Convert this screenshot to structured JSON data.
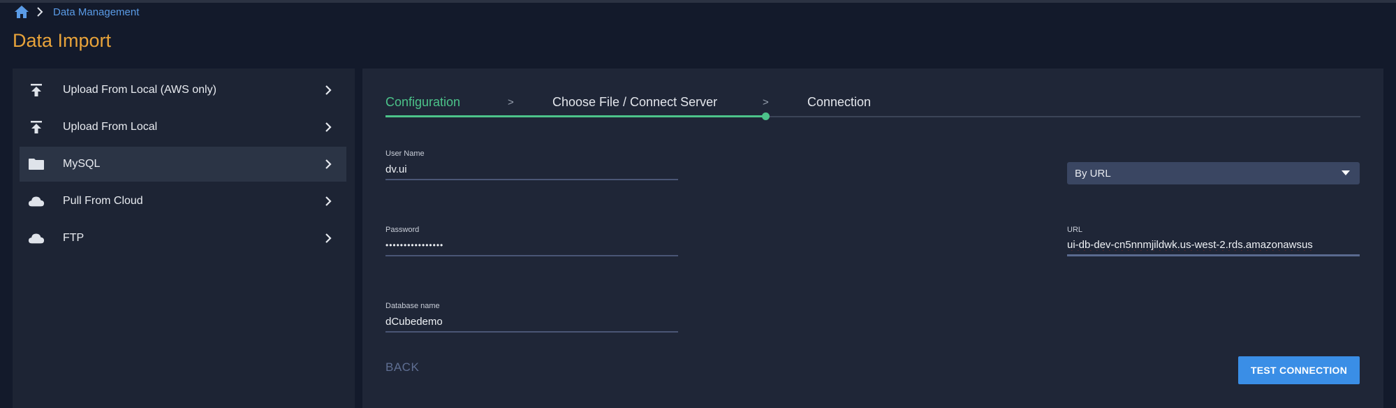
{
  "breadcrumb": {
    "items": [
      "Data Management"
    ]
  },
  "page": {
    "title": "Data Import"
  },
  "sidebar": {
    "items": [
      {
        "label": "Upload From Local (AWS only)",
        "icon": "upload-icon"
      },
      {
        "label": "Upload From Local",
        "icon": "upload-icon"
      },
      {
        "label": "MySQL",
        "icon": "folder-icon",
        "active": true
      },
      {
        "label": "Pull From Cloud",
        "icon": "cloud-icon"
      },
      {
        "label": "FTP",
        "icon": "cloud-icon"
      }
    ]
  },
  "stepper": {
    "steps": [
      "Configuration",
      "Choose File / Connect Server",
      "Connection"
    ],
    "separator": ">",
    "active_index": 0
  },
  "form": {
    "username": {
      "label": "User Name",
      "value": "dv.ui"
    },
    "password": {
      "label": "Password",
      "value": "••••••••••••••••"
    },
    "database": {
      "label": "Database name",
      "value": "dCubedemo"
    },
    "connection_mode": {
      "selected": "By URL"
    },
    "url": {
      "label": "URL",
      "value": "ui-db-dev-cn5nnmjildwk.us-west-2.rds.amazonawsus"
    }
  },
  "actions": {
    "back": "BACK",
    "test": "TEST CONNECTION"
  },
  "colors": {
    "accent": "#4cc38a",
    "title": "#e8a33a",
    "link": "#5a9be6",
    "primary_button": "#3a8ee6"
  }
}
